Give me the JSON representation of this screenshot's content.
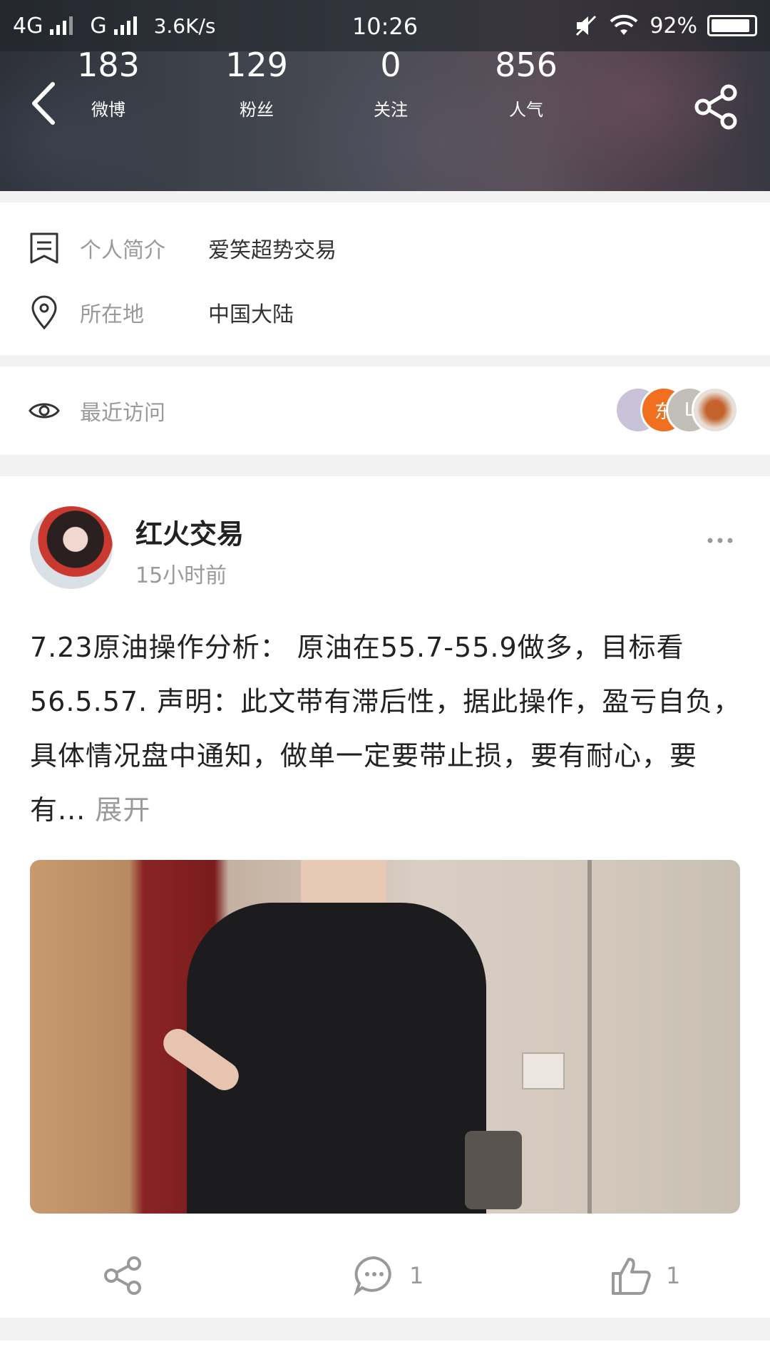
{
  "status_bar": {
    "network1": "4G",
    "network2": "G",
    "speed": "3.6K/s",
    "time": "10:26",
    "battery": "92%"
  },
  "header": {
    "stats": [
      {
        "num": "183",
        "label": "微博"
      },
      {
        "num": "129",
        "label": "粉丝"
      },
      {
        "num": "0",
        "label": "关注"
      },
      {
        "num": "856",
        "label": "人气"
      }
    ]
  },
  "profile": {
    "bio_key": "个人简介",
    "bio_val": "爱笑超势交易",
    "loc_key": "所在地",
    "loc_val": "中国大陆"
  },
  "visits": {
    "label": "最近访问",
    "avatar_letters": [
      "东",
      "L"
    ]
  },
  "post": {
    "name": "红火交易",
    "time": "15小时前",
    "text": "7.23原油操作分析： 原油在55.7-55.9做多，目标看56.5.57. 声明：此文带有滞后性，据此操作，盈亏自负，具体情况盘中通知，做单一定要带止损，要有耐心，要有... ",
    "expand": "展开",
    "comments": "1",
    "likes": "1"
  }
}
